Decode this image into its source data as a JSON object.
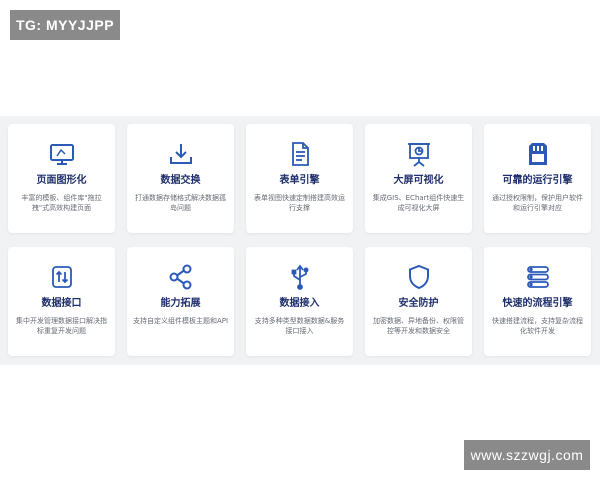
{
  "watermarks": {
    "top_left": "TG: MYYJJPP",
    "bottom_right": "www.szzwgj.com"
  },
  "colors": {
    "icon": "#2a59b8",
    "title": "#1f2f6b",
    "panel_bg": "#f1f2f4"
  },
  "cards": [
    {
      "title": "页面图形化",
      "desc": "丰富的模板、组件库\"拖拉拽\"式高效构建页面",
      "icon": "monitor-icon"
    },
    {
      "title": "数据交换",
      "desc": "打通数据存储格式解决数据孤岛问题",
      "icon": "download-icon"
    },
    {
      "title": "表单引擎",
      "desc": "表单视图快速定制搭建高效运行支撑",
      "icon": "document-icon"
    },
    {
      "title": "大屏可视化",
      "desc": "集成GIS、EChart组件快速生成可视化大屏",
      "icon": "presentation-icon"
    },
    {
      "title": "可靠的运行引擎",
      "desc": "通过授权限制，保护用户软件和运行引擎对应",
      "icon": "sd-card-icon"
    },
    {
      "title": "数据接口",
      "desc": "集中开发管理数据接口解决指标重复开发问题",
      "icon": "transfer-icon"
    },
    {
      "title": "能力拓展",
      "desc": "支持自定义组件模板主题和API",
      "icon": "share-icon"
    },
    {
      "title": "数据接入",
      "desc": "支持多种类型数据数据&服务接口接入",
      "icon": "usb-icon"
    },
    {
      "title": "安全防护",
      "desc": "加密数据、异地备份、权限管控等开发和数据安全",
      "icon": "shield-icon"
    },
    {
      "title": "快速的流程引擎",
      "desc": "快速搭建流程，支持复杂流程化软件开发",
      "icon": "list-icon"
    }
  ]
}
